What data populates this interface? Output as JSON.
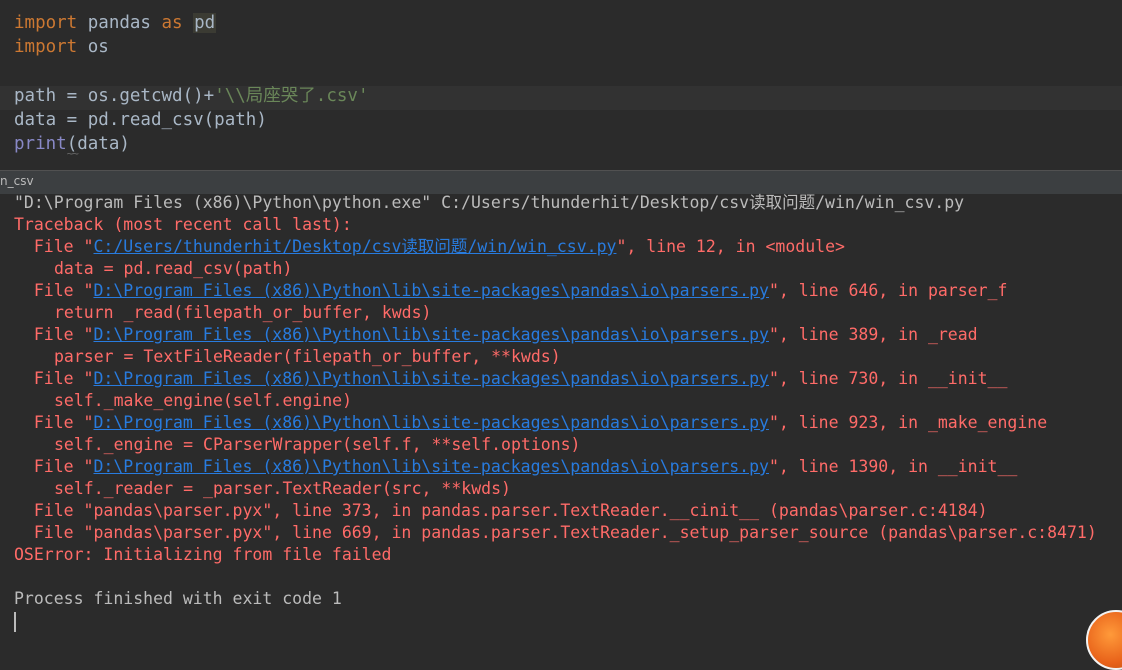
{
  "editor": {
    "line1": {
      "kw1": "import",
      "mod": " pandas ",
      "kw2": "as",
      "sp": " ",
      "alias": "pd"
    },
    "line2": {
      "kw": "import",
      "mod": " os"
    },
    "line4": {
      "pre": "path = os.getcwd()+",
      "str": "'\\\\局座哭了.csv'"
    },
    "line5": "data = pd.read_csv(path)",
    "line6": {
      "fn": "print",
      "args": "(data)"
    }
  },
  "run_tab": {
    "label": "n_csv"
  },
  "console": {
    "command": "\"D:\\Program Files (x86)\\Python\\python.exe\" C:/Users/thunderhit/Desktop/csv读取问题/win/win_csv.py",
    "traceback_header": "Traceback (most recent call last):",
    "frames": [
      {
        "file": "C:/Users/thunderhit/Desktop/csv读取问题/win/win_csv.py",
        "rest": "\", line 12, in <module>",
        "code": "data = pd.read_csv(path)"
      },
      {
        "file": "D:\\Program Files (x86)\\Python\\lib\\site-packages\\pandas\\io\\parsers.py",
        "rest": "\", line 646, in parser_f",
        "code": "return _read(filepath_or_buffer, kwds)"
      },
      {
        "file": "D:\\Program Files (x86)\\Python\\lib\\site-packages\\pandas\\io\\parsers.py",
        "rest": "\", line 389, in _read",
        "code": "parser = TextFileReader(filepath_or_buffer, **kwds)"
      },
      {
        "file": "D:\\Program Files (x86)\\Python\\lib\\site-packages\\pandas\\io\\parsers.py",
        "rest": "\", line 730, in __init__",
        "code": "self._make_engine(self.engine)"
      },
      {
        "file": "D:\\Program Files (x86)\\Python\\lib\\site-packages\\pandas\\io\\parsers.py",
        "rest": "\", line 923, in _make_engine",
        "code": "self._engine = CParserWrapper(self.f, **self.options)"
      },
      {
        "file": "D:\\Program Files (x86)\\Python\\lib\\site-packages\\pandas\\io\\parsers.py",
        "rest": "\", line 1390, in __init__",
        "code": "self._reader = _parser.TextReader(src, **kwds)"
      }
    ],
    "pyx1": "  File \"pandas\\parser.pyx\", line 373, in pandas.parser.TextReader.__cinit__ (pandas\\parser.c:4184)",
    "pyx2": "  File \"pandas\\parser.pyx\", line 669, in pandas.parser.TextReader._setup_parser_source (pandas\\parser.c:8471)",
    "error": "OSError: Initializing from file failed",
    "exit": "Process finished with exit code 1"
  }
}
